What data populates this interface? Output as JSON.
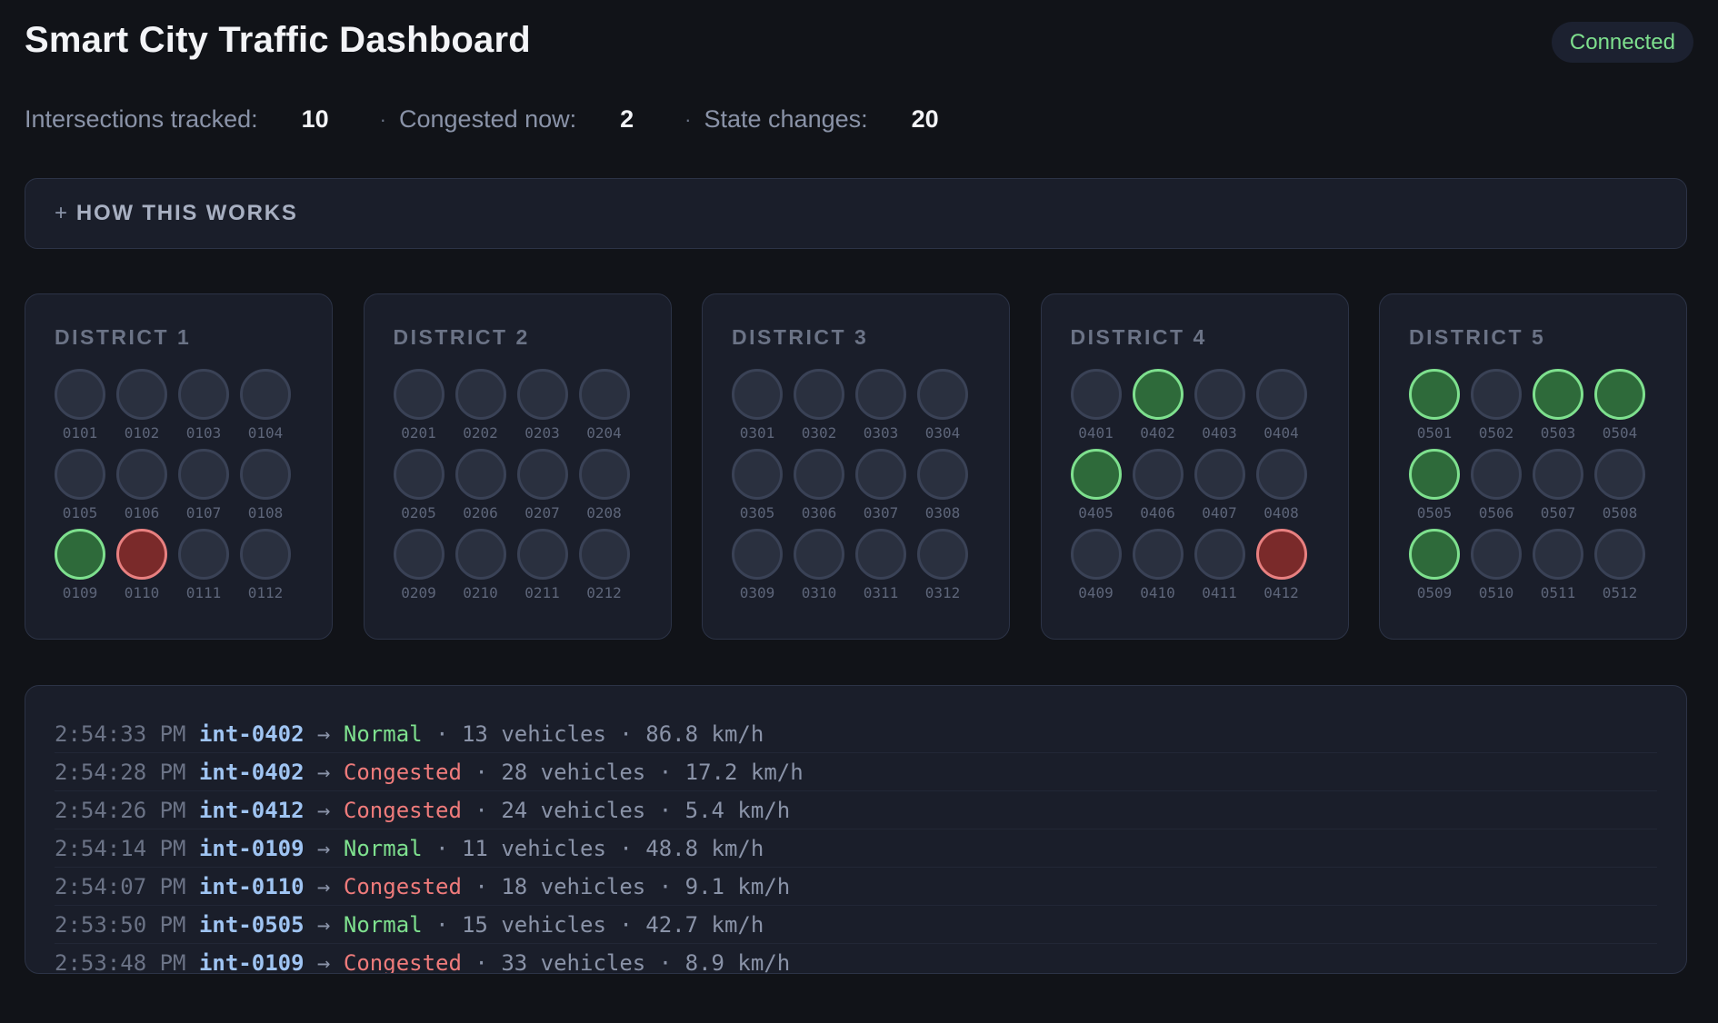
{
  "header": {
    "title": "Smart City Traffic Dashboard",
    "connection_status": "Connected"
  },
  "stats": [
    {
      "label": "Intersections tracked:",
      "value": "10"
    },
    {
      "label": "Congested now:",
      "value": "2"
    },
    {
      "label": "State changes:",
      "value": "20"
    }
  ],
  "stats_separator": "·",
  "howto": {
    "icon": "+",
    "label": "HOW THIS WORKS"
  },
  "districts": [
    {
      "title": "DISTRICT 1",
      "intersections": [
        {
          "id": "0101",
          "state": "idle"
        },
        {
          "id": "0102",
          "state": "idle"
        },
        {
          "id": "0103",
          "state": "idle"
        },
        {
          "id": "0104",
          "state": "idle"
        },
        {
          "id": "0105",
          "state": "idle"
        },
        {
          "id": "0106",
          "state": "idle"
        },
        {
          "id": "0107",
          "state": "idle"
        },
        {
          "id": "0108",
          "state": "idle"
        },
        {
          "id": "0109",
          "state": "normal"
        },
        {
          "id": "0110",
          "state": "congested"
        },
        {
          "id": "0111",
          "state": "idle"
        },
        {
          "id": "0112",
          "state": "idle"
        }
      ]
    },
    {
      "title": "DISTRICT 2",
      "intersections": [
        {
          "id": "0201",
          "state": "idle"
        },
        {
          "id": "0202",
          "state": "idle"
        },
        {
          "id": "0203",
          "state": "idle"
        },
        {
          "id": "0204",
          "state": "idle"
        },
        {
          "id": "0205",
          "state": "idle"
        },
        {
          "id": "0206",
          "state": "idle"
        },
        {
          "id": "0207",
          "state": "idle"
        },
        {
          "id": "0208",
          "state": "idle"
        },
        {
          "id": "0209",
          "state": "idle"
        },
        {
          "id": "0210",
          "state": "idle"
        },
        {
          "id": "0211",
          "state": "idle"
        },
        {
          "id": "0212",
          "state": "idle"
        }
      ]
    },
    {
      "title": "DISTRICT 3",
      "intersections": [
        {
          "id": "0301",
          "state": "idle"
        },
        {
          "id": "0302",
          "state": "idle"
        },
        {
          "id": "0303",
          "state": "idle"
        },
        {
          "id": "0304",
          "state": "idle"
        },
        {
          "id": "0305",
          "state": "idle"
        },
        {
          "id": "0306",
          "state": "idle"
        },
        {
          "id": "0307",
          "state": "idle"
        },
        {
          "id": "0308",
          "state": "idle"
        },
        {
          "id": "0309",
          "state": "idle"
        },
        {
          "id": "0310",
          "state": "idle"
        },
        {
          "id": "0311",
          "state": "idle"
        },
        {
          "id": "0312",
          "state": "idle"
        }
      ]
    },
    {
      "title": "DISTRICT 4",
      "intersections": [
        {
          "id": "0401",
          "state": "idle"
        },
        {
          "id": "0402",
          "state": "normal"
        },
        {
          "id": "0403",
          "state": "idle"
        },
        {
          "id": "0404",
          "state": "idle"
        },
        {
          "id": "0405",
          "state": "normal"
        },
        {
          "id": "0406",
          "state": "idle"
        },
        {
          "id": "0407",
          "state": "idle"
        },
        {
          "id": "0408",
          "state": "idle"
        },
        {
          "id": "0409",
          "state": "idle"
        },
        {
          "id": "0410",
          "state": "idle"
        },
        {
          "id": "0411",
          "state": "idle"
        },
        {
          "id": "0412",
          "state": "congested"
        }
      ]
    },
    {
      "title": "DISTRICT 5",
      "intersections": [
        {
          "id": "0501",
          "state": "normal"
        },
        {
          "id": "0502",
          "state": "idle"
        },
        {
          "id": "0503",
          "state": "normal"
        },
        {
          "id": "0504",
          "state": "normal"
        },
        {
          "id": "0505",
          "state": "normal"
        },
        {
          "id": "0506",
          "state": "idle"
        },
        {
          "id": "0507",
          "state": "idle"
        },
        {
          "id": "0508",
          "state": "idle"
        },
        {
          "id": "0509",
          "state": "normal"
        },
        {
          "id": "0510",
          "state": "idle"
        },
        {
          "id": "0511",
          "state": "idle"
        },
        {
          "id": "0512",
          "state": "idle"
        }
      ]
    }
  ],
  "log": [
    {
      "time": "2:54:33 PM",
      "id": "int-0402",
      "arrow": "→",
      "state": "Normal",
      "vehicles": "13 vehicles",
      "speed": "86.8 km/h"
    },
    {
      "time": "2:54:28 PM",
      "id": "int-0402",
      "arrow": "→",
      "state": "Congested",
      "vehicles": "28 vehicles",
      "speed": "17.2 km/h"
    },
    {
      "time": "2:54:26 PM",
      "id": "int-0412",
      "arrow": "→",
      "state": "Congested",
      "vehicles": "24 vehicles",
      "speed": "5.4 km/h"
    },
    {
      "time": "2:54:14 PM",
      "id": "int-0109",
      "arrow": "→",
      "state": "Normal",
      "vehicles": "11 vehicles",
      "speed": "48.8 km/h"
    },
    {
      "time": "2:54:07 PM",
      "id": "int-0110",
      "arrow": "→",
      "state": "Congested",
      "vehicles": "18 vehicles",
      "speed": "9.1 km/h"
    },
    {
      "time": "2:53:50 PM",
      "id": "int-0505",
      "arrow": "→",
      "state": "Normal",
      "vehicles": "15 vehicles",
      "speed": "42.7 km/h"
    },
    {
      "time": "2:53:48 PM",
      "id": "int-0109",
      "arrow": "→",
      "state": "Congested",
      "vehicles": "33 vehicles",
      "speed": "8.9 km/h"
    }
  ],
  "log_separator": "·",
  "colors": {
    "background": "#111318",
    "panel": "#1a1e2a",
    "normal": "#7ee08e",
    "congested": "#ef7b7b",
    "id_accent": "#9fc4f2"
  }
}
